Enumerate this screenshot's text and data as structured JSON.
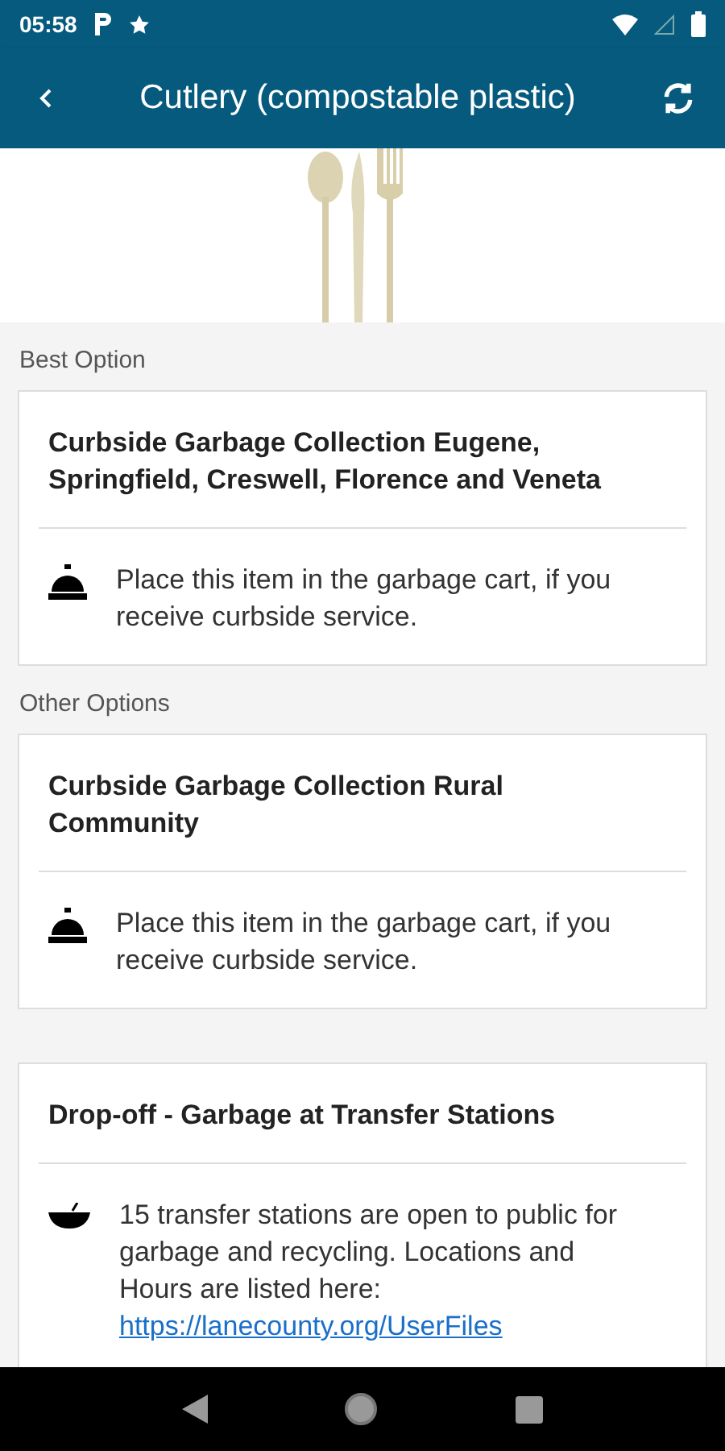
{
  "status_bar": {
    "time": "05:58"
  },
  "app_bar": {
    "title": "Cutlery (compostable plastic)"
  },
  "sections": [
    {
      "heading": "Best Option",
      "cards": [
        {
          "title": "Curbside Garbage Collection Eugene, Springfield, Creswell, Florence and Veneta",
          "kind": "curbside",
          "text": "Place this item in the garbage cart, if you receive curbside service."
        }
      ]
    },
    {
      "heading": "Other Options",
      "cards": [
        {
          "title": "Curbside Garbage Collection Rural Community",
          "kind": "curbside",
          "text": "Place this item in the garbage cart, if you receive curbside service."
        },
        {
          "title": "Drop-off - Garbage at Transfer Stations",
          "kind": "dropoff",
          "text": "15 transfer stations are open to public for garbage and recycling. Locations and Hours are listed here:",
          "link": "https://lanecounty.org/UserFiles"
        }
      ]
    }
  ]
}
